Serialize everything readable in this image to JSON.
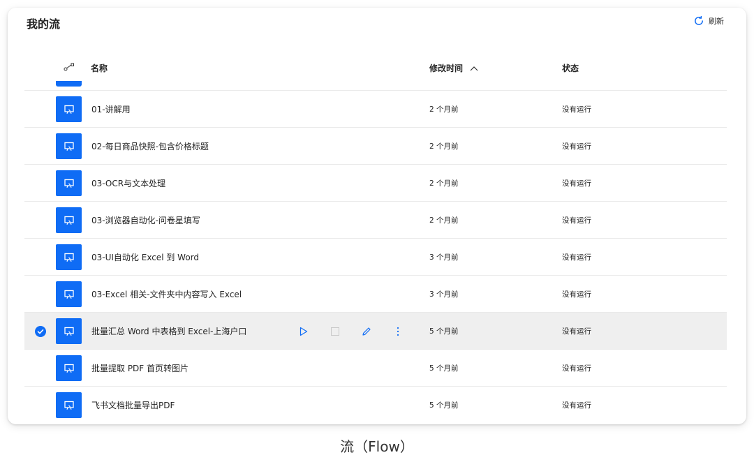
{
  "page": {
    "title": "我的流",
    "refresh_label": "刷新",
    "caption": "流（Flow）"
  },
  "table": {
    "columns": {
      "icon": "link-icon",
      "name": "名称",
      "modified": "修改时间",
      "status": "状态",
      "sort": "ascending"
    },
    "rows": [
      {
        "name": "01-讲解用",
        "modified": "2 个月前",
        "status": "没有运行",
        "selected": false
      },
      {
        "name": "02-每日商品快照-包含价格标题",
        "modified": "2 个月前",
        "status": "没有运行",
        "selected": false
      },
      {
        "name": "03-OCR与文本处理",
        "modified": "2 个月前",
        "status": "没有运行",
        "selected": false
      },
      {
        "name": "03-浏览器自动化-问卷星填写",
        "modified": "2 个月前",
        "status": "没有运行",
        "selected": false
      },
      {
        "name": "03-UI自动化 Excel 到 Word",
        "modified": "3 个月前",
        "status": "没有运行",
        "selected": false
      },
      {
        "name": "03-Excel 相关-文件夹中内容写入 Excel",
        "modified": "3 个月前",
        "status": "没有运行",
        "selected": false
      },
      {
        "name": "批量汇总 Word 中表格到 Excel-上海户口",
        "modified": "5 个月前",
        "status": "没有运行",
        "selected": true
      },
      {
        "name": "批量提取 PDF 首页转图片",
        "modified": "5 个月前",
        "status": "没有运行",
        "selected": false
      },
      {
        "name": "飞书文档批量导出PDF",
        "modified": "5 个月前",
        "status": "没有运行",
        "selected": false
      }
    ],
    "row_actions": [
      "run-icon",
      "stop-icon",
      "edit-icon",
      "more-icon"
    ]
  },
  "colors": {
    "accent": "#0f6cf5",
    "selected_row": "#efefef",
    "divider": "#e9e9e9"
  }
}
